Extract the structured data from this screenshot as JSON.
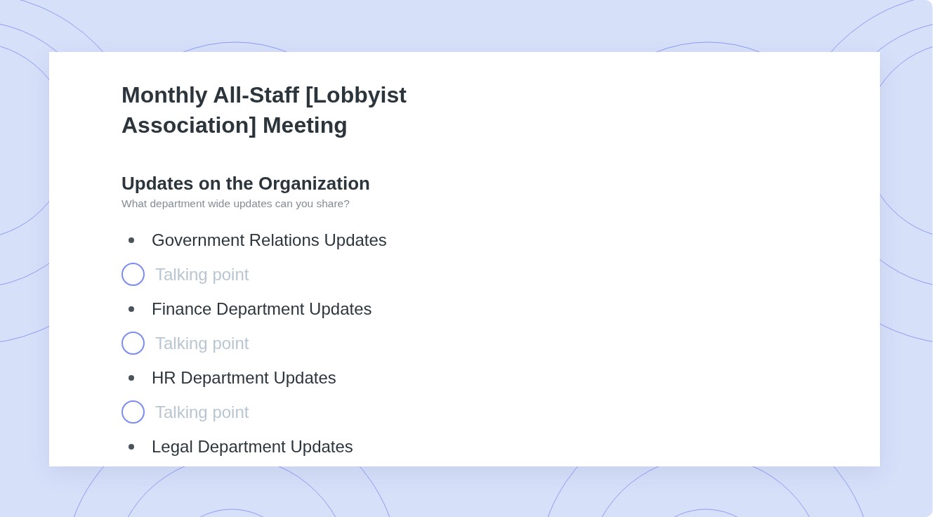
{
  "title": "Monthly All-Staff [Lobbyist Association] Meeting",
  "section": {
    "heading": "Updates on the Organization",
    "subtitle": "What department wide updates can you share?"
  },
  "items": [
    {
      "kind": "topic",
      "text": "Government Relations Updates"
    },
    {
      "kind": "talking_point",
      "placeholder": "Talking point",
      "checked": false
    },
    {
      "kind": "topic",
      "text": "Finance Department Updates"
    },
    {
      "kind": "talking_point",
      "placeholder": "Talking point",
      "checked": false
    },
    {
      "kind": "topic",
      "text": "HR Department Updates"
    },
    {
      "kind": "talking_point",
      "placeholder": "Talking point",
      "checked": false
    },
    {
      "kind": "topic",
      "text": "Legal Department Updates"
    }
  ]
}
